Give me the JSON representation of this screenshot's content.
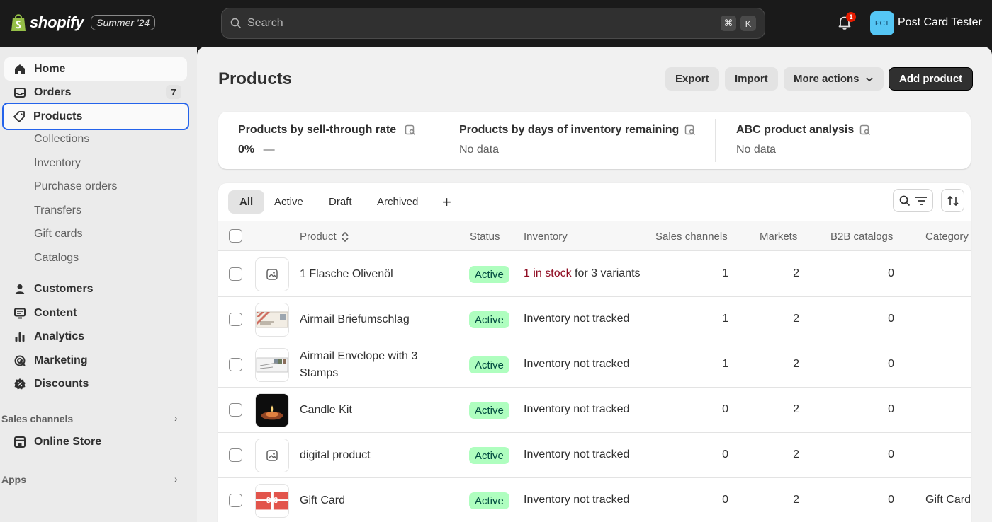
{
  "topbar": {
    "brand": "shopify",
    "edition": "Summer '24",
    "search_placeholder": "Search",
    "kbd_cmd": "⌘",
    "kbd_k": "K",
    "notification_count": "1",
    "avatar_initials": "PCT",
    "store_name": "Post Card Tester"
  },
  "sidebar": {
    "home": "Home",
    "orders": "Orders",
    "orders_count": "7",
    "products": "Products",
    "sub": [
      "Collections",
      "Inventory",
      "Purchase orders",
      "Transfers",
      "Gift cards",
      "Catalogs"
    ],
    "customers": "Customers",
    "content": "Content",
    "analytics": "Analytics",
    "marketing": "Marketing",
    "discounts": "Discounts",
    "sales_channels": "Sales channels",
    "online_store": "Online Store",
    "apps": "Apps"
  },
  "page": {
    "title": "Products",
    "export": "Export",
    "import": "Import",
    "more_actions": "More actions",
    "add_product": "Add product"
  },
  "metrics": [
    {
      "title": "Products by sell-through rate",
      "value": "0%",
      "trend": "—"
    },
    {
      "title": "Products by days of inventory remaining",
      "value": "No data"
    },
    {
      "title": "ABC product analysis",
      "value": "No data"
    }
  ],
  "tabs": [
    "All",
    "Active",
    "Draft",
    "Archived"
  ],
  "columns": {
    "product": "Product",
    "status": "Status",
    "inventory": "Inventory",
    "sales_channels": "Sales channels",
    "markets": "Markets",
    "b2b": "B2B catalogs",
    "category": "Category"
  },
  "rows": [
    {
      "name": "1 Flasche Olivenöl",
      "status": "Active",
      "inv_red": "1 in stock",
      "inv_rest": " for 3 variants",
      "inventory": "",
      "channels": "1",
      "markets": "2",
      "b2b": "0",
      "category": ""
    },
    {
      "name": "Airmail Briefumschlag",
      "status": "Active",
      "inventory": "Inventory not tracked",
      "channels": "1",
      "markets": "2",
      "b2b": "0",
      "category": ""
    },
    {
      "name": "Airmail Envelope with 3 Stamps",
      "status": "Active",
      "inventory": "Inventory not tracked",
      "channels": "1",
      "markets": "2",
      "b2b": "0",
      "category": ""
    },
    {
      "name": "Candle Kit",
      "status": "Active",
      "inventory": "Inventory not tracked",
      "channels": "0",
      "markets": "2",
      "b2b": "0",
      "category": ""
    },
    {
      "name": "digital product",
      "status": "Active",
      "inventory": "Inventory not tracked",
      "channels": "0",
      "markets": "2",
      "b2b": "0",
      "category": ""
    },
    {
      "name": "Gift Card",
      "status": "Active",
      "inventory": "Inventory not tracked",
      "channels": "0",
      "markets": "2",
      "b2b": "0",
      "category": "Gift Card"
    }
  ],
  "colors": {
    "accent_focus": "#2463eb",
    "active_badge_bg": "#affebf",
    "stock_warning": "#8e0b21",
    "topbar": "#1a1a1a"
  }
}
